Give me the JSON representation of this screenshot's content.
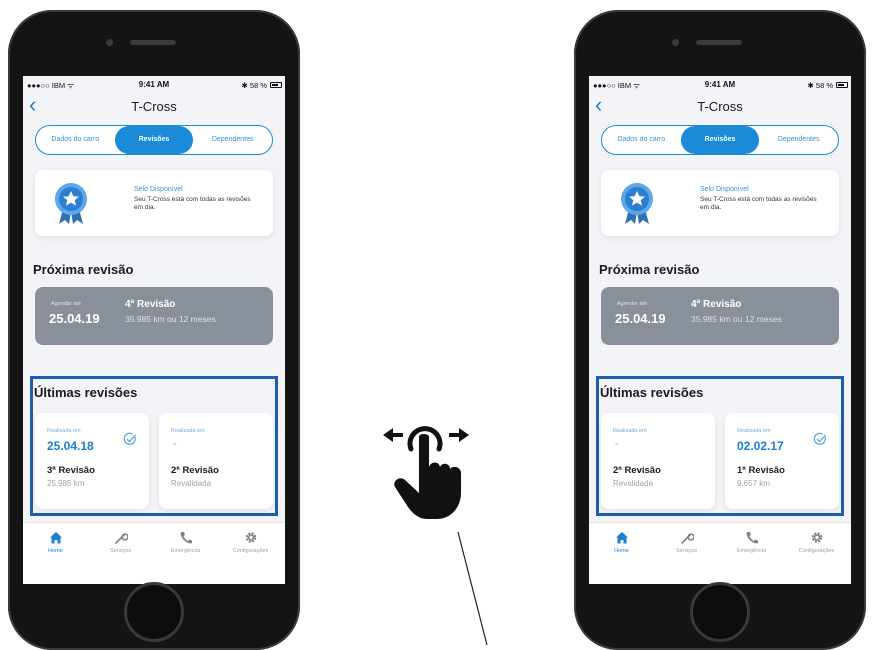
{
  "status_bar": {
    "carrier": "●●●○○ IBM ᯤ",
    "time": "9:41 AM",
    "battery": "✱ 58 %"
  },
  "nav": {
    "title": "T-Cross"
  },
  "segments": [
    "Dados do carro",
    "Revisões",
    "Dependentes"
  ],
  "selo": {
    "title": "Selo Disponível",
    "text": "Seu T-Cross está com todas as revisões em dia."
  },
  "next_section": {
    "heading": "Próxima revisão",
    "agendar_label": "Agendar até",
    "date": "25.04.19",
    "revision": "4ª Revisão",
    "detail": "35.985 km ou 12 meses"
  },
  "last_section": {
    "heading": "Últimas revisões"
  },
  "phone1_cards": [
    {
      "label": "Realizada em",
      "date": "25.04.18",
      "name": "3ª Revisão",
      "sub": "25.985 km"
    },
    {
      "label": "Realizada em",
      "date": "-",
      "name": "2ª Revisão",
      "sub": "Revalidada"
    }
  ],
  "phone2_cards": [
    {
      "label": "Realizada em",
      "date": "-",
      "name": "2ª Revisão",
      "sub": "Revalidada"
    },
    {
      "label": "Realizada em",
      "date": "02.02.17",
      "name": "1ª Revisão",
      "sub": "9.657 km"
    }
  ],
  "tabs": [
    "Home",
    "Serviços",
    "Emergência",
    "Configurações"
  ],
  "colors": {
    "accent": "#1a8ad9",
    "highlight": "#1c5fb0",
    "next_card": "#8a9099"
  },
  "icons": [
    "chevron-left-icon",
    "medal-star-icon",
    "check-circle-icon",
    "home-icon",
    "wrench-icon",
    "phone-icon",
    "gear-icon",
    "swipe-gesture-icon"
  ]
}
